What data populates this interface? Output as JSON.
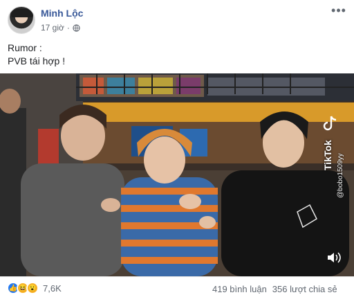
{
  "post": {
    "author": "Minh Lộc",
    "time": "17 giờ",
    "text_lines": [
      "Rumor :",
      "PVB tái hợp !"
    ]
  },
  "video": {
    "watermark": "TikTok",
    "username": "@bobo1509yy"
  },
  "icons": {
    "privacy": "globe-icon",
    "more": "more-options-icon",
    "sound": "volume-icon",
    "reactions": [
      "like-icon",
      "haha-icon",
      "wow-icon"
    ]
  },
  "engagement": {
    "reaction_count": "7,6K",
    "comments": "419 bình luận",
    "shares": "356 lượt chia sẻ"
  },
  "colors": {
    "author_link": "#385898",
    "like_blue": "#2078f4",
    "meta_gray": "#616770"
  }
}
